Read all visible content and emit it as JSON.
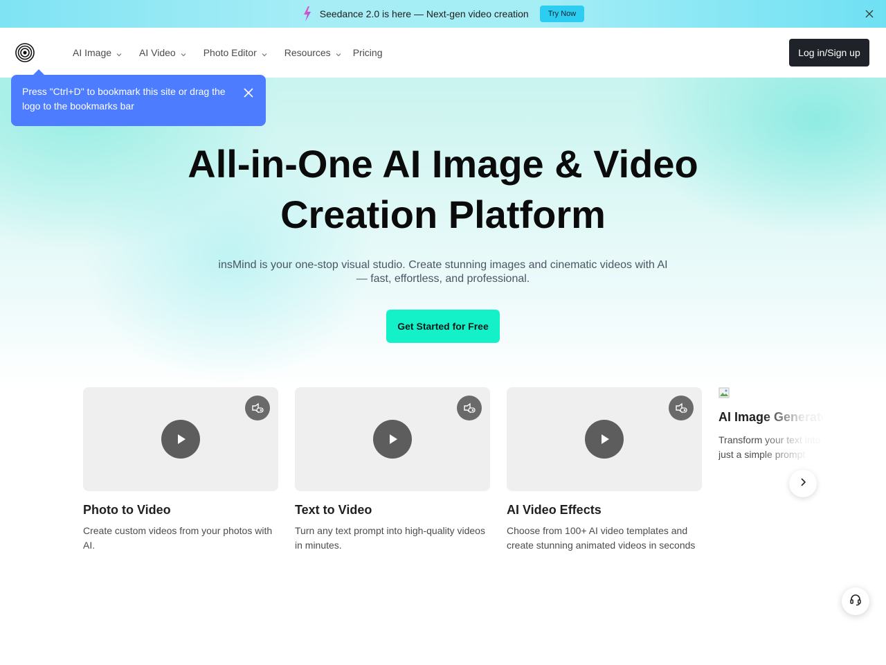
{
  "announcement": {
    "text": "Seedance 2.0 is here — Next-gen video creation",
    "button": "Try Now"
  },
  "nav": {
    "items": [
      {
        "label": "AI Image",
        "has_dropdown": true
      },
      {
        "label": "AI Video",
        "has_dropdown": true
      },
      {
        "label": "Photo Editor",
        "has_dropdown": true
      },
      {
        "label": "Resources",
        "has_dropdown": true
      },
      {
        "label": "Pricing",
        "has_dropdown": false
      }
    ],
    "login": "Log in/Sign up"
  },
  "tooltip": {
    "text": "Press \"Ctrl+D\" to bookmark this site or drag the logo to the bookmarks bar"
  },
  "hero": {
    "title_line1": "All-in-One AI Image & Video",
    "title_line2": "Creation Platform",
    "subtitle": "insMind is your one-stop visual studio. Create stunning images and cinematic videos with AI — fast, effortless, and professional.",
    "cta": "Get Started for Free"
  },
  "cards": [
    {
      "title": "Photo to Video",
      "desc": "Create custom videos from your photos with AI."
    },
    {
      "title": "Text to Video",
      "desc": "Turn any text prompt into high-quality videos in minutes."
    },
    {
      "title": "AI Video Effects",
      "desc": "Choose from 100+ AI video templates and create stunning animated videos in seconds"
    },
    {
      "title": "AI Image Generator",
      "desc": "Transform your text into images with just a simple prompt"
    }
  ],
  "colors": {
    "accent_cta": "#14f0c8",
    "tooltip_bg": "#4d7cfe",
    "login_bg": "#1f2228",
    "try_now_bg": "#2ccdf0"
  },
  "icons": {
    "announcement": "lightning-bolt-icon",
    "close": "close-icon",
    "logo": "concentric-circles-logo",
    "dropdown": "chevron-down-icon",
    "play": "play-icon",
    "mute": "speaker-mute-icon",
    "next": "chevron-right-icon",
    "support": "headset-icon"
  }
}
